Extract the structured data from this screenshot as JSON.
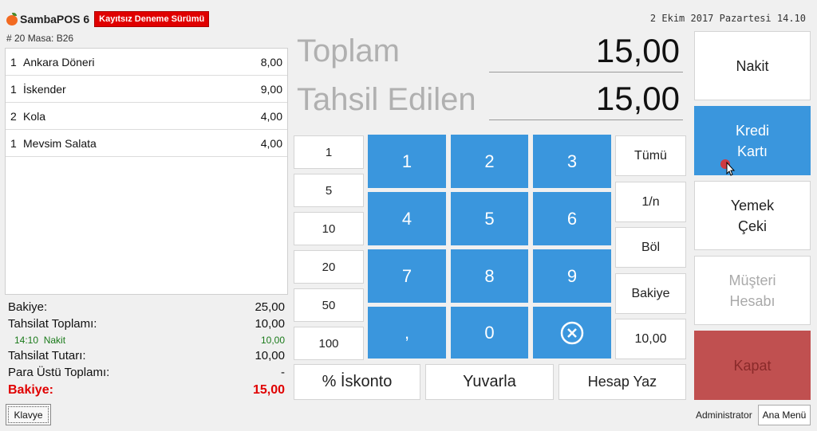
{
  "header": {
    "app_name": "SambaPOS 6",
    "trial_badge": "Kayıtsız Deneme Sürümü",
    "date": "2 Ekim 2017 Pazartesi 14.10"
  },
  "ticket": {
    "label": "# 20 Masa: B26"
  },
  "orders": [
    {
      "qty": "1",
      "name": "Ankara Döneri",
      "price": "8,00"
    },
    {
      "qty": "1",
      "name": "İskender",
      "price": "9,00"
    },
    {
      "qty": "2",
      "name": "Kola",
      "price": "4,00"
    },
    {
      "qty": "1",
      "name": "Mevsim Salata",
      "price": "4,00"
    }
  ],
  "summary": {
    "bakiye_label": "Bakiye:",
    "bakiye_value": "25,00",
    "tahsilat_toplami_label": "Tahsilat Toplamı:",
    "tahsilat_toplami_value": "10,00",
    "payment_time": "14:10",
    "payment_method": "Nakit",
    "payment_value": "10,00",
    "tahsilat_tutari_label": "Tahsilat Tutarı:",
    "tahsilat_tutari_value": "10,00",
    "para_ustu_label": "Para Üstü Toplamı:",
    "para_ustu_value": "-",
    "final_bakiye_label": "Bakiye:",
    "final_bakiye_value": "15,00"
  },
  "klavye_label": "Klavye",
  "totals": {
    "toplam_label": "Toplam",
    "toplam_value": "15,00",
    "tahsil_label": "Tahsil Edilen",
    "tahsil_value": "15,00"
  },
  "quick_amounts": [
    "1",
    "5",
    "10",
    "20",
    "50",
    "100"
  ],
  "numpad": [
    "1",
    "2",
    "3",
    "4",
    "5",
    "6",
    "7",
    "8",
    "9",
    ",",
    "0"
  ],
  "side_buttons": [
    "Tümü",
    "1/n",
    "Böl",
    "Bakiye",
    "10,00"
  ],
  "bottom_buttons": {
    "iskonto": "% İskonto",
    "yuvarla": "Yuvarla",
    "hesap_yaz": "Hesap Yaz"
  },
  "payment_buttons": {
    "nakit": "Nakit",
    "kredi": "Kredi\nKartı",
    "yemek": "Yemek\nÇeki",
    "musteri": "Müşteri\nHesabı",
    "kapat": "Kapat"
  },
  "footer": {
    "user": "Administrator",
    "ana_menu": "Ana Menü"
  },
  "colors": {
    "accent_blue": "#3a96dd",
    "close_red": "#c05050",
    "badge_red": "#e00000",
    "green_text": "#1a7a1a"
  },
  "icons": {
    "clear": "clear-icon",
    "logo": "sambapos-logo-icon"
  }
}
